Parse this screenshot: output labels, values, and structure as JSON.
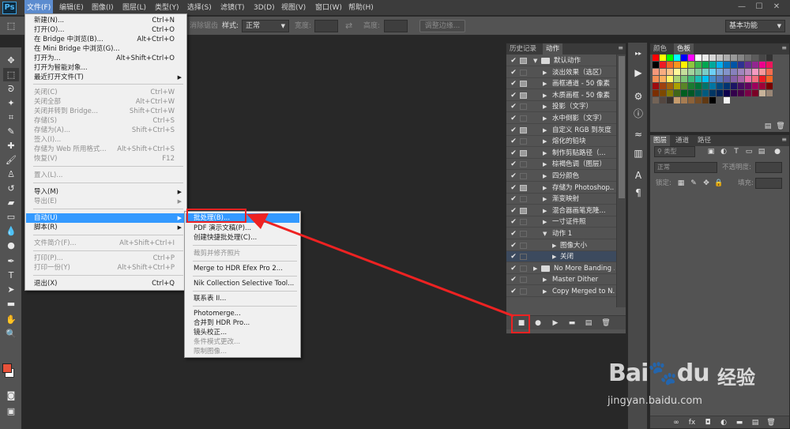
{
  "app": {
    "logo": "Ps"
  },
  "menubar": {
    "items": [
      "文件(F)",
      "编辑(E)",
      "图像(I)",
      "图层(L)",
      "类型(Y)",
      "选择(S)",
      "滤镜(T)",
      "3D(D)",
      "视图(V)",
      "窗口(W)",
      "帮助(H)"
    ],
    "window_buttons": [
      "—",
      "☐",
      "✕"
    ]
  },
  "options_bar": {
    "antialias_label": "消除锯齿",
    "style_label": "样式:",
    "style_value": "正常",
    "width_label": "宽度:",
    "height_label": "高度:",
    "adjust_edge_label": "调整边缘...",
    "workspace_value": "基本功能"
  },
  "file_menu": {
    "items": [
      {
        "label": "新建(N)...",
        "shortcut": "Ctrl+N",
        "disabled": false
      },
      {
        "label": "打开(O)...",
        "shortcut": "Ctrl+O",
        "disabled": false
      },
      {
        "label": "在 Bridge 中浏览(B)...",
        "shortcut": "Alt+Ctrl+O",
        "disabled": false
      },
      {
        "label": "在 Mini Bridge 中浏览(G)...",
        "shortcut": "",
        "disabled": false
      },
      {
        "label": "打开为...",
        "shortcut": "Alt+Shift+Ctrl+O",
        "disabled": false
      },
      {
        "label": "打开为智能对象...",
        "shortcut": "",
        "disabled": false
      },
      {
        "label": "最近打开文件(T)",
        "shortcut": "",
        "disabled": false
      },
      {
        "label": "关闭(C)",
        "shortcut": "Ctrl+W",
        "disabled": true
      },
      {
        "label": "关闭全部",
        "shortcut": "Alt+Ctrl+W",
        "disabled": true
      },
      {
        "label": "关闭并转到 Bridge...",
        "shortcut": "Shift+Ctrl+W",
        "disabled": true
      },
      {
        "label": "存储(S)",
        "shortcut": "Ctrl+S",
        "disabled": true
      },
      {
        "label": "存储为(A)...",
        "shortcut": "Shift+Ctrl+S",
        "disabled": true
      },
      {
        "label": "签入(I)...",
        "shortcut": "",
        "disabled": true
      },
      {
        "label": "存储为 Web 所用格式...",
        "shortcut": "Alt+Shift+Ctrl+S",
        "disabled": true
      },
      {
        "label": "恢复(V)",
        "shortcut": "F12",
        "disabled": true
      },
      {
        "label": "置入(L)...",
        "shortcut": "",
        "disabled": true
      },
      {
        "label": "导入(M)",
        "shortcut": "",
        "disabled": false
      },
      {
        "label": "导出(E)",
        "shortcut": "",
        "disabled": true
      },
      {
        "label": "自动(U)",
        "shortcut": "",
        "disabled": false
      },
      {
        "label": "脚本(R)",
        "shortcut": "",
        "disabled": false
      },
      {
        "label": "文件简介(F)...",
        "shortcut": "Alt+Shift+Ctrl+I",
        "disabled": true
      },
      {
        "label": "打印(P)...",
        "shortcut": "Ctrl+P",
        "disabled": true
      },
      {
        "label": "打印一份(Y)",
        "shortcut": "Alt+Shift+Ctrl+P",
        "disabled": true
      },
      {
        "label": "退出(X)",
        "shortcut": "Ctrl+Q",
        "disabled": false
      }
    ]
  },
  "automate_menu": {
    "items": [
      {
        "label": "批处理(B)...",
        "disabled": false
      },
      {
        "label": "PDF 演示文稿(P)...",
        "disabled": false
      },
      {
        "label": "创建快捷批处理(C)...",
        "disabled": false
      },
      {
        "label": "裁剪并修齐照片",
        "disabled": true
      },
      {
        "label": "Merge to HDR Efex Pro 2...",
        "disabled": false
      },
      {
        "label": "Nik Collection Selective Tool...",
        "disabled": false
      },
      {
        "label": "联系表 II...",
        "disabled": false
      },
      {
        "label": "Photomerge...",
        "disabled": false
      },
      {
        "label": "合并到 HDR Pro...",
        "disabled": false
      },
      {
        "label": "镜头校正...",
        "disabled": false
      },
      {
        "label": "条件模式更改...",
        "disabled": true
      },
      {
        "label": "限制图像...",
        "disabled": true
      }
    ]
  },
  "actions_panel": {
    "tabs": [
      "历史记录",
      "动作"
    ],
    "rows": [
      {
        "label": "默认动作",
        "type": "set"
      },
      {
        "label": "淡出效果（选区）",
        "type": "action"
      },
      {
        "label": "画框通道 - 50 像素",
        "type": "action"
      },
      {
        "label": "木质画框 - 50 像素",
        "type": "action"
      },
      {
        "label": "投影（文字）",
        "type": "action"
      },
      {
        "label": "水中倒影（文字）",
        "type": "action"
      },
      {
        "label": "自定义 RGB 到灰度",
        "type": "action"
      },
      {
        "label": "熔化的铅块",
        "type": "action"
      },
      {
        "label": "制作剪贴路径（...",
        "type": "action"
      },
      {
        "label": "棕褐色调（图层）",
        "type": "action"
      },
      {
        "label": "四分颜色",
        "type": "action"
      },
      {
        "label": "存储为 Photoshop...",
        "type": "action"
      },
      {
        "label": "渐变映射",
        "type": "action"
      },
      {
        "label": "混合器画笔克隆...",
        "type": "action"
      },
      {
        "label": "一寸证件照",
        "type": "action"
      },
      {
        "label": "动作 1",
        "type": "action-open"
      },
      {
        "label": "图像大小",
        "type": "step"
      },
      {
        "label": "关闭",
        "type": "step"
      },
      {
        "label": "No More Banding ...",
        "type": "set"
      },
      {
        "label": "Master Dither",
        "type": "action"
      },
      {
        "label": "Copy Merged to N...",
        "type": "action"
      }
    ]
  },
  "swatches_panel": {
    "tabs": [
      "颜色",
      "色板"
    ],
    "colors": [
      "#ff0000",
      "#ffff00",
      "#00ff00",
      "#00ffff",
      "#0000ff",
      "#ff00ff",
      "#ffffff",
      "#ebebeb",
      "#d6d6d6",
      "#c2c2c2",
      "#adadad",
      "#999999",
      "#858585",
      "#707070",
      "#5c5c5c",
      "#474747",
      "#333333",
      "#000000",
      "#ee1c24",
      "#f26522",
      "#f7941d",
      "#fff200",
      "#8dc63f",
      "#39b54a",
      "#00a651",
      "#00a99d",
      "#00aeef",
      "#0072bc",
      "#0054a6",
      "#2e3192",
      "#662d91",
      "#92278f",
      "#ec008c",
      "#ed145b",
      "#f7977a",
      "#f9ad81",
      "#fdc689",
      "#fff799",
      "#c4df9b",
      "#a3d39c",
      "#82ca9c",
      "#7accc8",
      "#6dcff6",
      "#7da7d9",
      "#8393ca",
      "#8781bd",
      "#a186be",
      "#bd8cbf",
      "#f49ac1",
      "#f5989d",
      "#f26c4f",
      "#f68e56",
      "#fbaf5d",
      "#fff568",
      "#acd373",
      "#7cc576",
      "#3cb878",
      "#1cbbb4",
      "#00bff3",
      "#448ccb",
      "#5674b9",
      "#605ca8",
      "#8560a8",
      "#a864a8",
      "#f06eaa",
      "#f26d7d",
      "#ed1c24",
      "#f26522",
      "#9e0b0f",
      "#a0410d",
      "#a36209",
      "#aba000",
      "#598527",
      "#1a7b30",
      "#007236",
      "#00746b",
      "#0076a3",
      "#004b80",
      "#003471",
      "#1b1464",
      "#440e62",
      "#630460",
      "#9e005d",
      "#9e0039",
      "#790000",
      "#7b2e00",
      "#7d4900",
      "#827b00",
      "#406618",
      "#005e20",
      "#005826",
      "#005952",
      "#005b7f",
      "#003663",
      "#002157",
      "#0d004c",
      "#32004b",
      "#4b0049",
      "#7b0046",
      "#7a0026",
      "#c7b299",
      "#998675",
      "#736357",
      "#534741",
      "#37302d",
      "#c69c6d",
      "#a67c52",
      "#8c6239",
      "#754c24",
      "#603913",
      "#000000",
      "#555555",
      "#f5f5f5"
    ]
  },
  "layers_panel": {
    "tabs": [
      "图层",
      "通道",
      "路径"
    ],
    "kind_label": "类型",
    "blend_mode": "正常",
    "opacity_label": "不透明度:",
    "lock_label": "锁定:",
    "fill_label": "填充:"
  },
  "watermark": {
    "brand": "Bai",
    "brand2": "du",
    "cn": "经验",
    "url": "jingyan.baidu.com"
  },
  "colors": {
    "highlight": "#3399ff",
    "callout": "#ee2222",
    "menubar_active": "#5c8ccf"
  }
}
